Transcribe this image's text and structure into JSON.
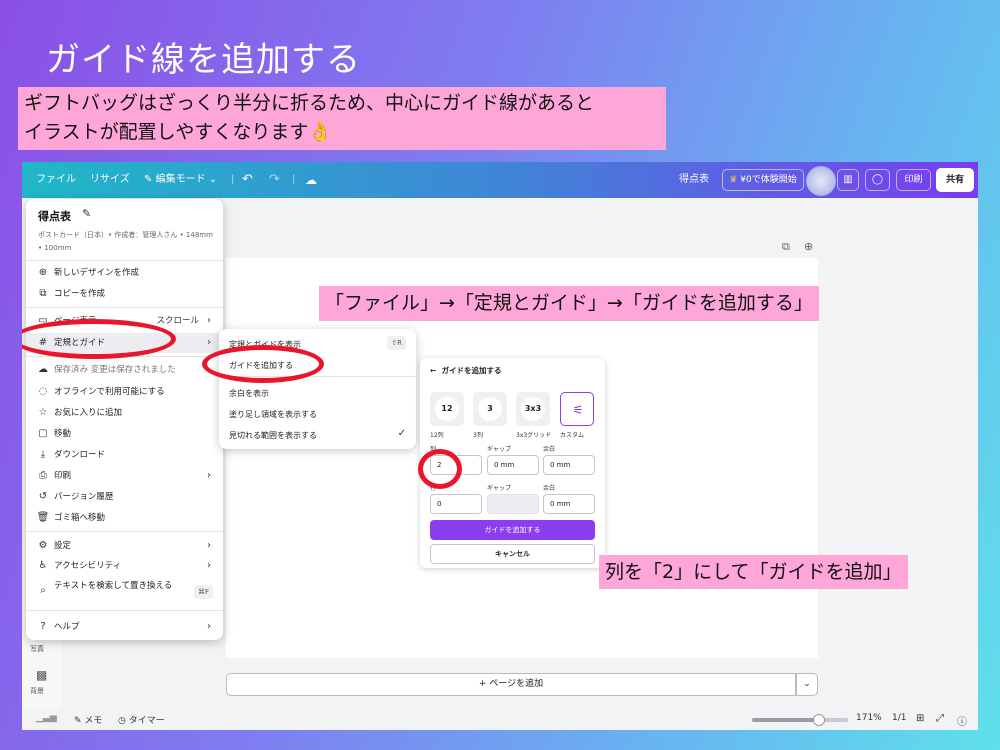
{
  "slide": {
    "title": "ガイド線を追加する",
    "note_line1": "ギフトバッグはざっくり半分に折るため、中心にガイド線があると",
    "note_line2": "イラストが配置しやすくなります👌",
    "callout_top": "「ファイル」→「定規とガイド」→「ガイドを追加する」",
    "callout_bottom": "列を「2」にして「ガイドを追加」",
    "annotation_color": "#e8152b",
    "callout_color": "#ffa6d9"
  },
  "topbar": {
    "file": "ファイル",
    "resize": "リサイズ",
    "edit_mode": "編集モード",
    "undo_icon": "undo-icon",
    "redo_icon": "redo-icon",
    "doc_name": "得点表",
    "trial": "¥0で体験開始",
    "print": "印刷",
    "share": "共有"
  },
  "file_menu": {
    "title": "得点表",
    "meta": "ポストカード（日本）• 作成者：管理人さん • 148mm • 100mm",
    "items": {
      "new_design": "新しいデザインを作成",
      "copy": "コピーを作成",
      "view": "ページ表示",
      "view_right": "スクロール",
      "rulers": "定規とガイド",
      "saved": "保存済み 変更は保存されました",
      "offline": "オフラインで利用可能にする",
      "favorite": "お気に入りに追加",
      "move": "移動",
      "download": "ダウンロード",
      "print": "印刷",
      "history": "バージョン履歴",
      "trash": "ゴミ箱へ移動",
      "settings": "設定",
      "accessibility": "アクセシビリティ",
      "find_replace": "テキストを検索して置き換える",
      "find_shortcut": "⌘F",
      "help": "ヘルプ"
    }
  },
  "submenu": {
    "show_rulers": "定規とガイドを表示",
    "show_rulers_shortcut": "⇧R",
    "add_guides": "ガイドを追加する",
    "show_margins": "余白を表示",
    "show_bleed": "塗り足し領域を表示する",
    "show_crop": "見切れる範囲を表示する"
  },
  "guide_panel": {
    "header": "ガイドを追加する",
    "presets": [
      {
        "value": "12",
        "label": "12列"
      },
      {
        "value": "3",
        "label": "3列"
      },
      {
        "value": "3x3",
        "label": "3x3グリッド"
      },
      {
        "value": "",
        "label": "カスタム"
      }
    ],
    "col_label": "列",
    "gap_label": "ギャップ",
    "margin_label": "余白",
    "row_label": "行",
    "columns": "2",
    "col_gap": "0 mm",
    "col_margin": "0 mm",
    "rows": "0",
    "row_gap": "",
    "row_margin": "0 mm",
    "add_button": "ガイドを追加する",
    "cancel_button": "キャンセル",
    "accent_color": "#8b3df0"
  },
  "canvas": {
    "add_page": "+ ページを追加"
  },
  "bottombar": {
    "memo": "メモ",
    "timer": "タイマー",
    "zoom": "171%",
    "zoom_level": 0.7,
    "page": "1/1"
  },
  "sidebar": {
    "photos": "写真",
    "background": "背景"
  }
}
